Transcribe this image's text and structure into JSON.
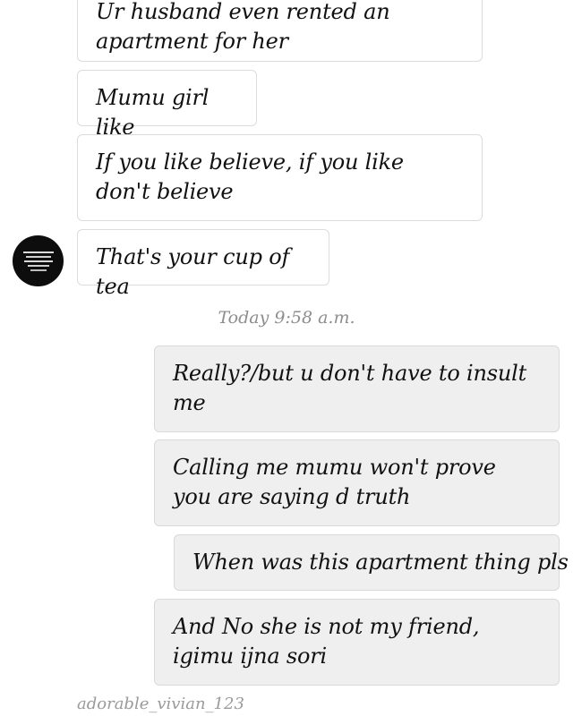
{
  "messages_received": [
    {
      "text": "Ur husband even rented an apartment for her"
    },
    {
      "text": "Mumu girl like"
    },
    {
      "text": "If you like believe, if you like don't believe"
    },
    {
      "text": "That's your cup of tea"
    }
  ],
  "avatar": {
    "icon": "profile-avatar-icon"
  },
  "timestamp": "Today 9:58 a.m.",
  "messages_sent": [
    {
      "text": "Really?/but u don't have to insult me"
    },
    {
      "text": "Calling me mumu won't prove you are saying d truth"
    },
    {
      "text": "When was this apartment thing pls"
    },
    {
      "text": "And No she is not my friend, igimu ijna sori"
    }
  ],
  "watermark": "adorable_vivian_123",
  "colors": {
    "received_bubble": "#ffffff",
    "sent_bubble": "#efefef",
    "border": "#dcdcdc",
    "timestamp": "#8e8e8e"
  }
}
